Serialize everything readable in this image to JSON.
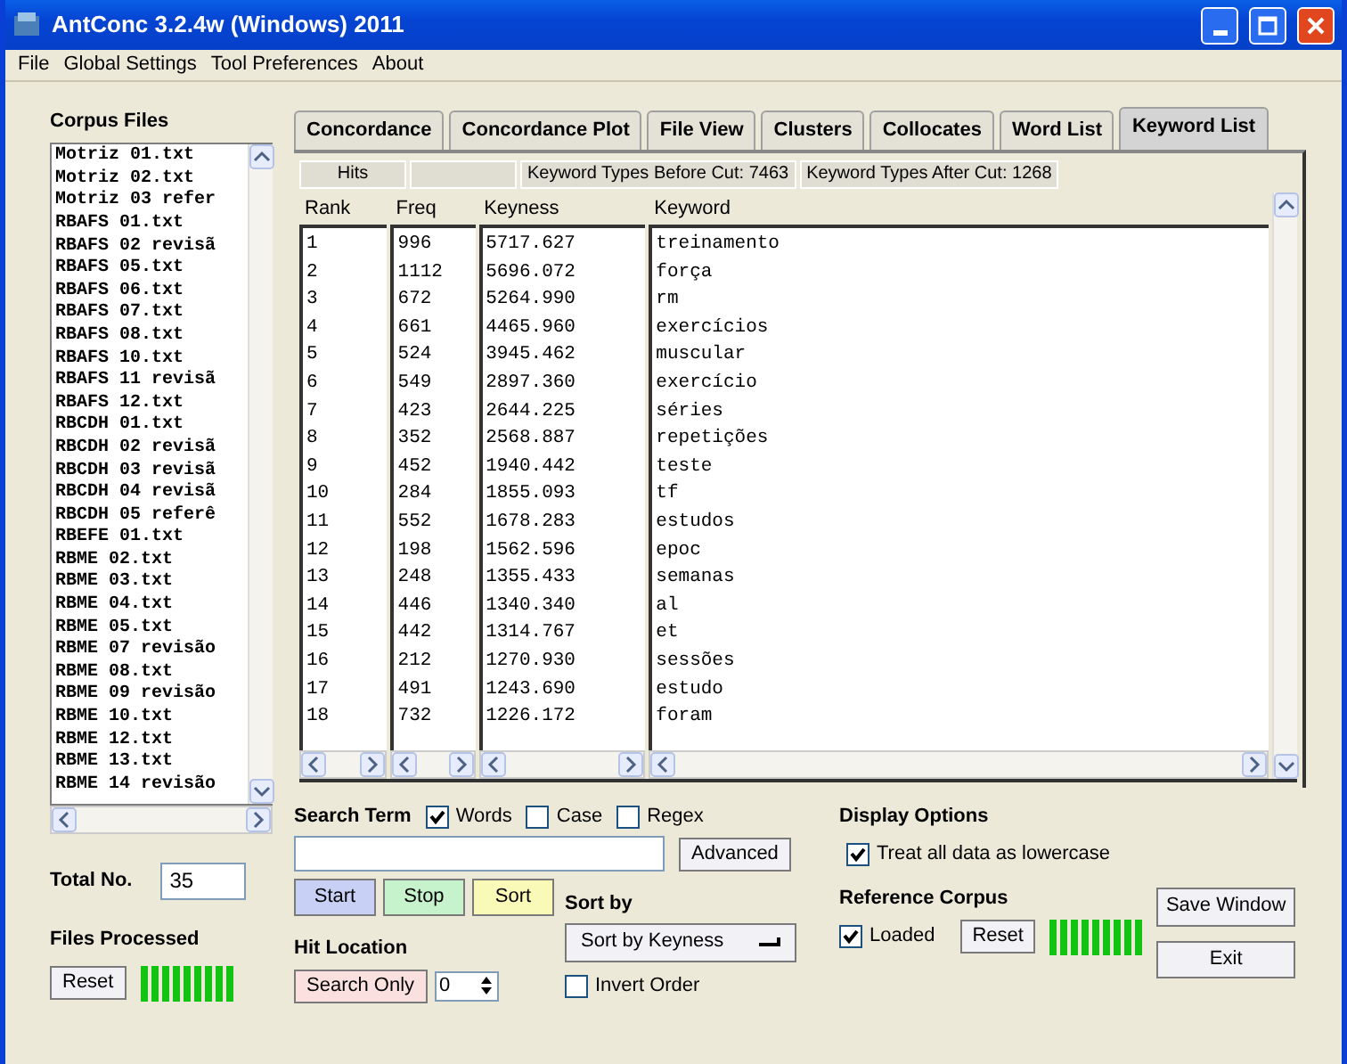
{
  "window": {
    "title": "AntConc 3.2.4w (Windows) 2011"
  },
  "menu": [
    "File",
    "Global Settings",
    "Tool Preferences",
    "About"
  ],
  "corpus_files": {
    "title": "Corpus Files",
    "files": [
      "Motriz 01.txt",
      "Motriz 02.txt",
      "Motriz 03 refer",
      "RBAFS 01.txt",
      "RBAFS 02 revisã",
      "RBAFS 05.txt",
      "RBAFS 06.txt",
      "RBAFS 07.txt",
      "RBAFS 08.txt",
      "RBAFS 10.txt",
      "RBAFS 11 revisã",
      "RBAFS 12.txt",
      "RBCDH 01.txt",
      "RBCDH 02 revisã",
      "RBCDH 03 revisã",
      "RBCDH 04 revisã",
      "RBCDH 05 referê",
      "RBEFE 01.txt",
      "RBME 02.txt",
      "RBME 03.txt",
      "RBME 04.txt",
      "RBME 05.txt",
      "RBME 07 revisão",
      "RBME 08.txt",
      "RBME 09 revisão",
      "RBME 10.txt",
      "RBME 12.txt",
      "RBME 13.txt",
      "RBME 14 revisão"
    ]
  },
  "total": {
    "label": "Total No.",
    "value": "35"
  },
  "files_processed": {
    "title": "Files Processed",
    "reset": "Reset"
  },
  "tabs": [
    {
      "label": "Concordance",
      "selected": false
    },
    {
      "label": "Concordance Plot",
      "selected": false
    },
    {
      "label": "File View",
      "selected": false
    },
    {
      "label": "Clusters",
      "selected": false
    },
    {
      "label": "Collocates",
      "selected": false
    },
    {
      "label": "Word List",
      "selected": false
    },
    {
      "label": "Keyword List",
      "selected": true
    }
  ],
  "hits_bar": {
    "hits": "Hits",
    "before_cut": "Keyword Types Before Cut: 7463",
    "after_cut": "Keyword Types After Cut: 1268"
  },
  "table": {
    "columns": [
      "Rank",
      "Freq",
      "Keyness",
      "Keyword"
    ],
    "rows": [
      [
        "1",
        "996",
        "5717.627",
        "treinamento"
      ],
      [
        "2",
        "1112",
        "5696.072",
        "força"
      ],
      [
        "3",
        "672",
        "5264.990",
        "rm"
      ],
      [
        "4",
        "661",
        "4465.960",
        "exercícios"
      ],
      [
        "5",
        "524",
        "3945.462",
        "muscular"
      ],
      [
        "6",
        "549",
        "2897.360",
        "exercício"
      ],
      [
        "7",
        "423",
        "2644.225",
        "séries"
      ],
      [
        "8",
        "352",
        "2568.887",
        "repetições"
      ],
      [
        "9",
        "452",
        "1940.442",
        "teste"
      ],
      [
        "10",
        "284",
        "1855.093",
        "tf"
      ],
      [
        "11",
        "552",
        "1678.283",
        "estudos"
      ],
      [
        "12",
        "198",
        "1562.596",
        "epoc"
      ],
      [
        "13",
        "248",
        "1355.433",
        "semanas"
      ],
      [
        "14",
        "446",
        "1340.340",
        "al"
      ],
      [
        "15",
        "442",
        "1314.767",
        "et"
      ],
      [
        "16",
        "212",
        "1270.930",
        "sessões"
      ],
      [
        "17",
        "491",
        "1243.690",
        "estudo"
      ],
      [
        "18",
        "732",
        "1226.172",
        "foram"
      ]
    ]
  },
  "search": {
    "title": "Search Term",
    "options": [
      {
        "label": "Words",
        "checked": true
      },
      {
        "label": "Case",
        "checked": false
      },
      {
        "label": "Regex",
        "checked": false
      }
    ],
    "advanced": "Advanced"
  },
  "actions": [
    {
      "label": "Start",
      "kind": "start"
    },
    {
      "label": "Stop",
      "kind": "stop"
    },
    {
      "label": "Sort",
      "kind": "sort"
    }
  ],
  "hit_location": {
    "title": "Hit Location",
    "button": "Search Only",
    "value": "0"
  },
  "sort": {
    "title": "Sort by",
    "value": "Sort by Keyness",
    "invert": {
      "label": "Invert Order",
      "checked": false
    }
  },
  "display_options": {
    "title": "Display Options",
    "lowercase": {
      "label": "Treat all data as lowercase",
      "checked": true
    }
  },
  "reference_corpus": {
    "title": "Reference Corpus",
    "loaded": {
      "label": "Loaded",
      "checked": true
    },
    "reset": "Reset"
  },
  "buttons": [
    "Save Window",
    "Exit"
  ]
}
